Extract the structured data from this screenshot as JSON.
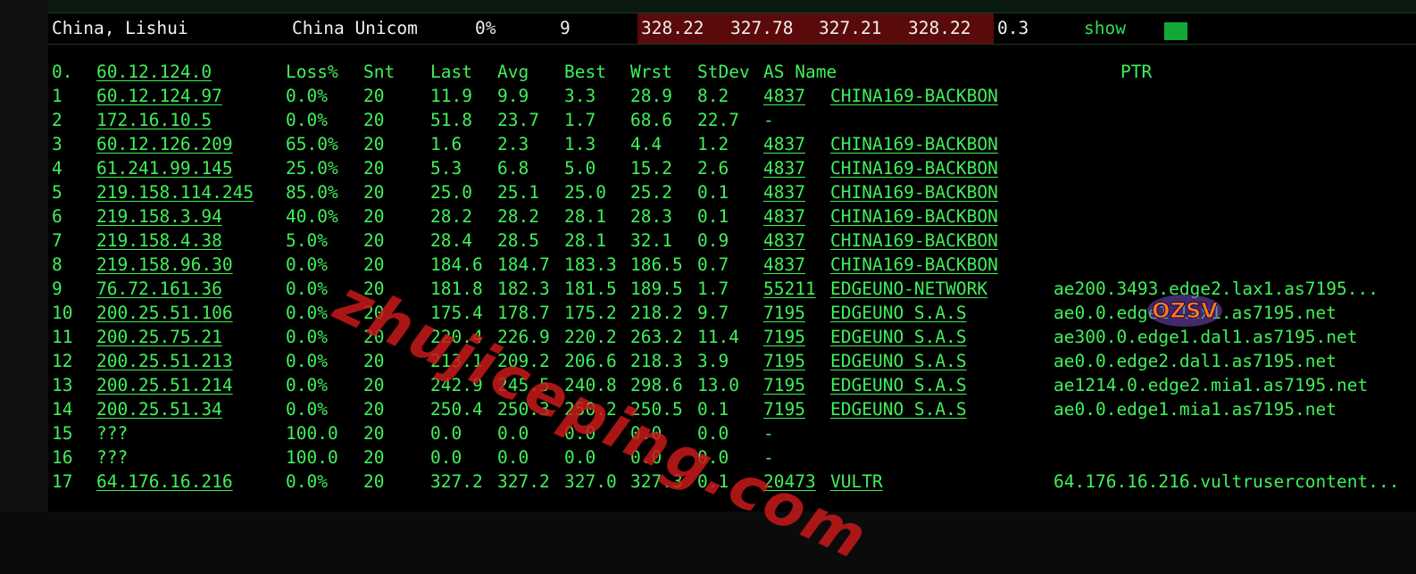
{
  "summary": {
    "location": "China, Lishui",
    "isp": "China Unicom",
    "loss": "0%",
    "count": "9",
    "latencies": [
      "328.22",
      "327.78",
      "327.21",
      "328.22"
    ],
    "stdev": "0.3",
    "action_label": "show"
  },
  "colors": {
    "terminal_text": "#40f05a",
    "latency_highlight": "#5a0a0a",
    "status_ok": "#13a836",
    "watermark": "#c81919"
  },
  "trace": {
    "columns": [
      "0.",
      "60.12.124.0",
      "Loss%",
      "Snt",
      "Last",
      "Avg",
      "Best",
      "Wrst",
      "StDev",
      "AS Name",
      "PTR"
    ],
    "rows": [
      [
        "1",
        "60.12.124.97",
        "0.0%",
        "20",
        "11.9",
        "9.9",
        "3.3",
        "28.9",
        "8.2",
        "4837",
        "CHINA169-BACKBON",
        ""
      ],
      [
        "2",
        "172.16.10.5",
        "0.0%",
        "20",
        "51.8",
        "23.7",
        "1.7",
        "68.6",
        "22.7",
        "-",
        "",
        ""
      ],
      [
        "3",
        "60.12.126.209",
        "65.0%",
        "20",
        "1.6",
        "2.3",
        "1.3",
        "4.4",
        "1.2",
        "4837",
        "CHINA169-BACKBON",
        ""
      ],
      [
        "4",
        "61.241.99.145",
        "25.0%",
        "20",
        "5.3",
        "6.8",
        "5.0",
        "15.2",
        "2.6",
        "4837",
        "CHINA169-BACKBON",
        ""
      ],
      [
        "5",
        "219.158.114.245",
        "85.0%",
        "20",
        "25.0",
        "25.1",
        "25.0",
        "25.2",
        "0.1",
        "4837",
        "CHINA169-BACKBON",
        ""
      ],
      [
        "6",
        "219.158.3.94",
        "40.0%",
        "20",
        "28.2",
        "28.2",
        "28.1",
        "28.3",
        "0.1",
        "4837",
        "CHINA169-BACKBON",
        ""
      ],
      [
        "7",
        "219.158.4.38",
        "5.0%",
        "20",
        "28.4",
        "28.5",
        "28.1",
        "32.1",
        "0.9",
        "4837",
        "CHINA169-BACKBON",
        ""
      ],
      [
        "8",
        "219.158.96.30",
        "0.0%",
        "20",
        "184.6",
        "184.7",
        "183.3",
        "186.5",
        "0.7",
        "4837",
        "CHINA169-BACKBON",
        ""
      ],
      [
        "9",
        "76.72.161.36",
        "0.0%",
        "20",
        "181.8",
        "182.3",
        "181.5",
        "189.5",
        "1.7",
        "55211",
        "EDGEUNO-NETWORK",
        "ae200.3493.edge2.lax1.as7195..."
      ],
      [
        "10",
        "200.25.51.106",
        "0.0%",
        "20",
        "175.4",
        "178.7",
        "175.2",
        "218.2",
        "9.7",
        "7195",
        "EDGEUNO S.A.S",
        "ae0.0.edge1.lax1.as7195.net"
      ],
      [
        "11",
        "200.25.75.21",
        "0.0%",
        "20",
        "220.4",
        "226.9",
        "220.2",
        "263.2",
        "11.4",
        "7195",
        "EDGEUNO S.A.S",
        "ae300.0.edge1.dal1.as7195.net"
      ],
      [
        "12",
        "200.25.51.213",
        "0.0%",
        "20",
        "213.1",
        "209.2",
        "206.6",
        "218.3",
        "3.9",
        "7195",
        "EDGEUNO S.A.S",
        "ae0.0.edge2.dal1.as7195.net"
      ],
      [
        "13",
        "200.25.51.214",
        "0.0%",
        "20",
        "242.9",
        "245.5",
        "240.8",
        "298.6",
        "13.0",
        "7195",
        "EDGEUNO S.A.S",
        "ae1214.0.edge2.mia1.as7195.net"
      ],
      [
        "14",
        "200.25.51.34",
        "0.0%",
        "20",
        "250.4",
        "250.3",
        "250.2",
        "250.5",
        "0.1",
        "7195",
        "EDGEUNO S.A.S",
        "ae0.0.edge1.mia1.as7195.net"
      ],
      [
        "15",
        "???",
        "100.0",
        "20",
        "0.0",
        "0.0",
        "0.0",
        "0.0",
        "0.0",
        "-",
        "",
        ""
      ],
      [
        "16",
        "???",
        "100.0",
        "20",
        "0.0",
        "0.0",
        "0.0",
        "0.0",
        "0.0",
        "-",
        "",
        ""
      ],
      [
        "17",
        "64.176.16.216",
        "0.0%",
        "20",
        "327.2",
        "327.2",
        "327.0",
        "327.3",
        "0.1",
        "20473",
        "VULTR",
        "64.176.16.216.vultrusercontent..."
      ]
    ]
  },
  "watermark_text": "zhujiceping.com",
  "logo_text": "OZSV"
}
